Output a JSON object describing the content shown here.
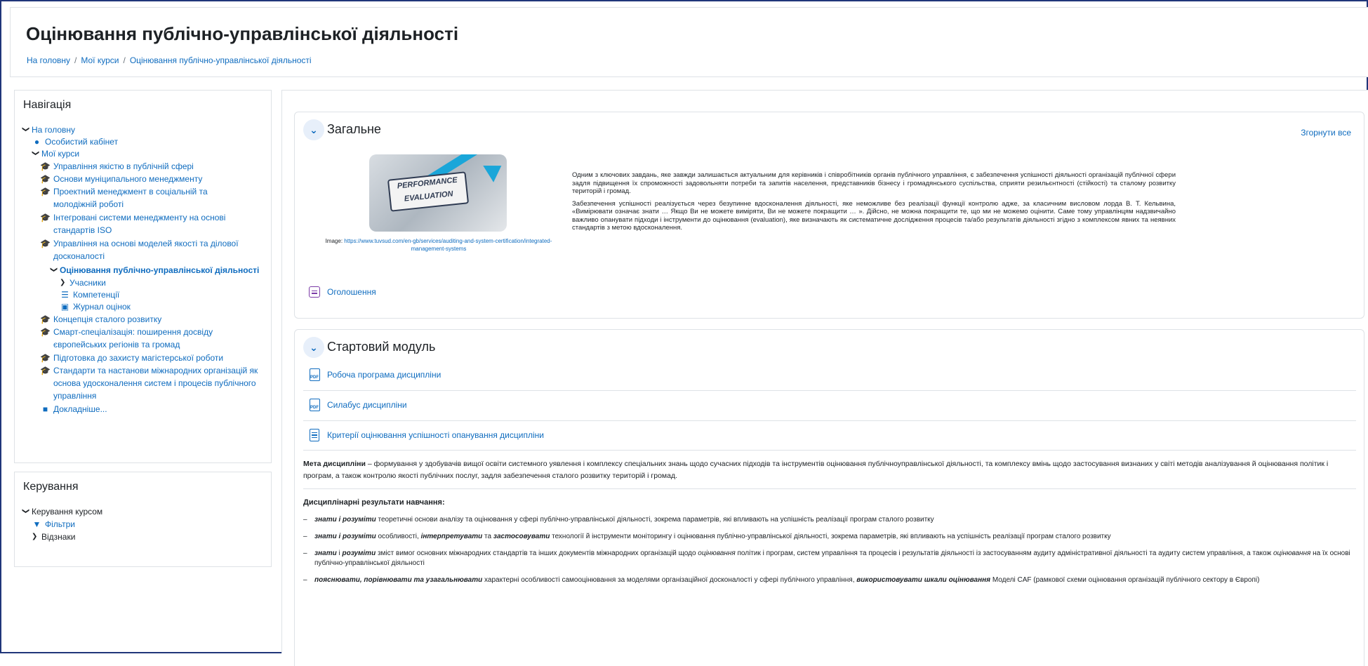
{
  "header": {
    "title": "Оцінювання публічно-управлінської діяльності",
    "breadcrumbs": [
      "На головну",
      "Мої курси",
      "Оцінювання публічно-управлінської діяльності"
    ]
  },
  "navigation": {
    "title": "Навігація",
    "items": [
      {
        "label": "На головну"
      },
      {
        "label": "Особистий кабінет"
      },
      {
        "label": "Мої курси"
      },
      {
        "label": "Управління якістю в публічній сфері"
      },
      {
        "label": "Основи муніципального менеджменту"
      },
      {
        "label": "Проектний менеджмент в соціальній та молодіжній роботі"
      },
      {
        "label": "Інтегровані системи менеджменту на основі стандартів ISO"
      },
      {
        "label": "Управління на основі моделей якості та ділової досконалості"
      },
      {
        "label": "Оцінювання публічно-управлінської діяльності"
      },
      {
        "label": "Учасники"
      },
      {
        "label": "Компетенції"
      },
      {
        "label": "Журнал оцінок"
      },
      {
        "label": "Концепція сталого розвитку"
      },
      {
        "label": "Смарт-спеціалізація: поширення досвіду європейських регіонів та громад"
      },
      {
        "label": "Підготовка до захисту магістерської роботи"
      },
      {
        "label": "Стандарти та настанови міжнародних організацій як основа удосконалення систем і процесів публічного управління"
      },
      {
        "label": "Докладніше..."
      }
    ]
  },
  "management": {
    "title": "Керування",
    "items": [
      {
        "label": "Керування курсом"
      },
      {
        "label": "Фільтри"
      },
      {
        "label": "Відзнаки"
      }
    ]
  },
  "general": {
    "title": "Загальне",
    "collapse_all": "Згорнути все",
    "image_badge_line1": "PERFORMANCE",
    "image_badge_line2": "EVALUATION",
    "caption_prefix": "Image: ",
    "caption_link": "https://www.tuvsud.com/en-gb/services/auditing-and-system-certification/integrated-management-systems",
    "paragraph1": "Одним з ключових завдань, яке завжди залишається актуальним для керівників і співробітників органів публічного управління, є забезпечення успішності діяльності організацій публічної сфери задля підвищення їх спроможності задовольняти потреби та запитів населення, представників бізнесу і громадянського суспільства, сприяти резильєнтності (стійкості) та сталому розвитку територій і громад.",
    "paragraph2": "Забезпечення успішності реалізується через безупинне вдосконалення діяльності, яке неможливе без реалізації функції контролю адже, за класичним висловом лорда В. Т. Кельвина, «Вимірювати означає знати … Якщо Ви не можете виміряти, Ви не можете покращити … ». Дійсно, не можна покращити те, що ми не можемо оцінити. Саме тому управлінцям надзвичайно важливо опанувати підходи і інструменти до оцінювання (evaluation), яке визначають як систематичне дослідження процесів та/або результатів діяльності згідно з комплексом явних та неявних стандартів з метою вдосконалення.",
    "announcements": "Оголошення"
  },
  "start_module": {
    "title": "Стартовий модуль",
    "pdf_label": "PDF",
    "activities": [
      "Робоча програма дисципліни",
      "Силабус дисципліни",
      "Критерії оцінювання успішності опанування дисципліни"
    ],
    "goal_label": "Мета дисципліни",
    "goal_text": " – формування у здобувачів вищої освіти системного уявлення і комплексу спеціальних знань щодо сучасних підходів та інструментів оцінювання публічноуправлінської діяльності, та комплексу вмінь щодо застосування визнаних у світі методів аналізування й оцінювання політик і програм, а також контролю якості публічних послуг, задля забезпечення сталого розвитку територій і громад.",
    "results_title": "Дисциплінарні результати навчання:",
    "results": [
      {
        "a": "знати і розуміти",
        "b": " теоретичні основи аналізу та оцінювання у сфері публічно-управлінської діяльності, зокрема параметрів, які впливають на успішність реалізації програм сталого розвитку"
      },
      {
        "a": "знати і розуміти",
        "b": " особливості, ",
        "c": "інтерпретувати",
        "d": " та ",
        "e": "застосовувати",
        "f": " технології й інструменти моніторингу і оцінювання публічно-управлінської діяльності, зокрема параметрів, які впливають на успішність реалізації програм сталого розвитку"
      },
      {
        "a": "знати",
        "b": " і ",
        "c": "розуміти",
        "d": " зміст вимог основних міжнародних стандартів та інших документів міжнародних організацій щодо ",
        "e": "оцінювання",
        "f": " політик і програм, систем управління та процесів і результатів діяльності із застосуванням аудиту адміністративної діяльності та аудиту систем управління, а також ",
        "g": "оцінювання",
        "h": " на їх основі публічно-управлінської діяльності"
      },
      {
        "a": "пояснювати, порівнювати та узагальнювати",
        "b": " характерні особливості самооцінювання за моделями організаційної досконалості у сфері публічного управління, ",
        "c": "використовувати шкали оцінювання",
        "d": " Моделі CAF (рамкової схеми оцінювання організацій публічного сектору в Європі)"
      }
    ]
  }
}
